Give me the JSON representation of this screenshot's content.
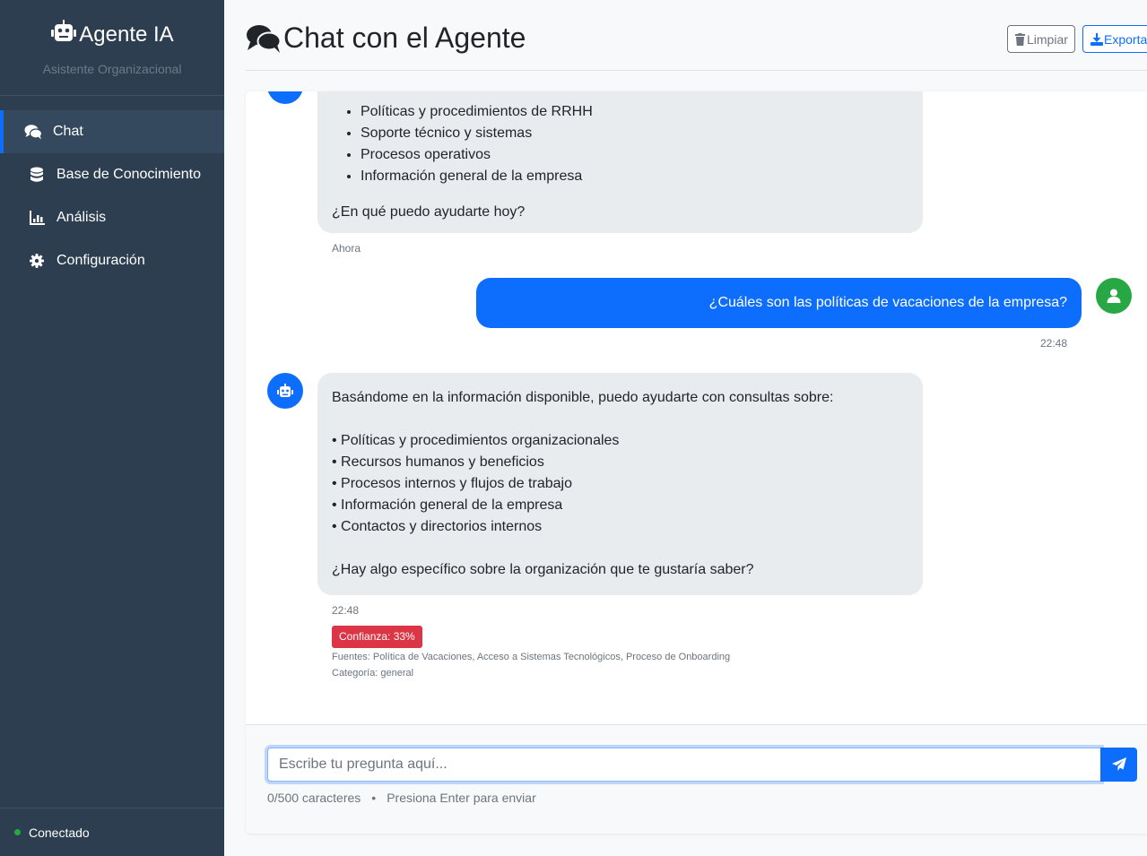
{
  "sidebar": {
    "brand_title": "Agente IA",
    "brand_subtitle": "Asistente Organizacional",
    "items": [
      {
        "label": "Chat",
        "icon": "comments-icon",
        "active": true
      },
      {
        "label": "Base de Conocimiento",
        "icon": "database-icon",
        "active": false
      },
      {
        "label": "Análisis",
        "icon": "chart-icon",
        "active": false
      },
      {
        "label": "Configuración",
        "icon": "gear-icon",
        "active": false
      }
    ],
    "status": "Conectado"
  },
  "header": {
    "title": "Chat con el Agente",
    "clear_label": "Limpiar",
    "export_label": "Exportar"
  },
  "messages": {
    "welcome": {
      "list": [
        "Políticas y procedimientos de RRHH",
        "Soporte técnico y sistemas",
        "Procesos operativos",
        "Información general de la empresa"
      ],
      "closing": "¿En qué puedo ayudarte hoy?",
      "time": "Ahora"
    },
    "user": {
      "text": "¿Cuáles son las políticas de vacaciones de la empresa?",
      "time": "22:48"
    },
    "reply": {
      "intro": "Basándome en la información disponible, puedo ayudarte con consultas sobre:",
      "bullets": [
        "• Políticas y procedimientos organizacionales",
        "• Recursos humanos y beneficios",
        "• Procesos internos y flujos de trabajo",
        "• Información general de la empresa",
        "• Contactos y directorios internos"
      ],
      "question": "¿Hay algo específico sobre la organización que te gustaría saber?",
      "time": "22:48",
      "confidence": "Confianza: 33%",
      "sources": "Fuentes: Política de Vacaciones, Acceso a Sistemas Tecnológicos, Proceso de Onboarding",
      "category": "Categoría: general"
    }
  },
  "input": {
    "placeholder": "Escribe tu pregunta aquí...",
    "counter": "0/500 caracteres",
    "separator": "•",
    "hint": "Presiona Enter para enviar"
  },
  "colors": {
    "sidebar_bg": "#2c3e50",
    "primary": "#0d6efd",
    "success": "#28a745",
    "danger": "#dc3545"
  }
}
